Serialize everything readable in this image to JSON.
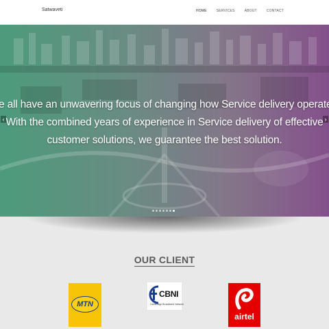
{
  "navbar": {
    "brand": "Satwaveti",
    "links": [
      {
        "label": "HOME",
        "active": true
      },
      {
        "label": "SERVICES",
        "active": false
      },
      {
        "label": "ABOUT",
        "active": false
      },
      {
        "label": "CONTACT",
        "active": false
      }
    ]
  },
  "hero": {
    "text": "We all have an unwavering focus of changing how Service delivery operates. With the combined years of experience in Service delivery of effective customer solutions, we guarantee the best solution.",
    "prev_icon": "chevron-left-icon",
    "next_icon": "chevron-right-icon",
    "slide_count": 7,
    "active_slide": 7,
    "gradient_colors": [
      "#28af78",
      "#8c2896"
    ]
  },
  "clients": {
    "title": "OUR CLIENT",
    "logos": [
      {
        "name": "MTN",
        "text": "MTN",
        "color": "#f7c407"
      },
      {
        "name": "CBNI",
        "text": "CBNI",
        "tagline": "Cambridge Broadband Network",
        "color": "#1a3d8f"
      },
      {
        "name": "airtel",
        "text": "airtel",
        "color": "#e40000"
      }
    ]
  }
}
